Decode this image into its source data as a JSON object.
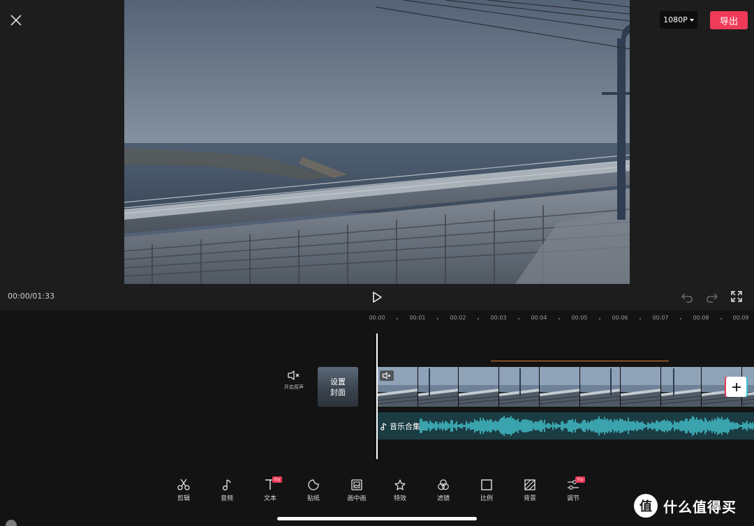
{
  "header": {
    "resolution_label": "1080P",
    "export_label": "导出"
  },
  "player": {
    "time_display": "00:00/01:33"
  },
  "timeline": {
    "ruler_ticks": [
      "00:00",
      "00:01",
      "00:02",
      "00:03",
      "00:04",
      "00:05",
      "00:06",
      "00:07",
      "00:08",
      "00:09"
    ],
    "mute_label": "开启原声",
    "cover_line1": "设置",
    "cover_line2": "封面",
    "audio_track_label": "音乐合集"
  },
  "toolbar": {
    "items": [
      {
        "label": "剪辑",
        "icon": "scissors-icon"
      },
      {
        "label": "音频",
        "icon": "music-note-icon"
      },
      {
        "label": "文本",
        "icon": "text-icon",
        "badge": "try"
      },
      {
        "label": "贴纸",
        "icon": "sticker-icon"
      },
      {
        "label": "画中画",
        "icon": "picture-in-picture-icon"
      },
      {
        "label": "特效",
        "icon": "effects-star-icon"
      },
      {
        "label": "滤镜",
        "icon": "filter-circles-icon"
      },
      {
        "label": "比例",
        "icon": "ratio-square-icon"
      },
      {
        "label": "背景",
        "icon": "background-hatch-icon"
      },
      {
        "label": "调节",
        "icon": "adjust-sliders-icon",
        "badge": "try"
      }
    ]
  },
  "watermark": {
    "symbol": "值",
    "text": "什么值得买"
  },
  "colors": {
    "accent": "#ef3b59",
    "audio_waveform": "#3aa3ad",
    "audio_track_bg": "#1b3c43",
    "background": "#131313"
  }
}
